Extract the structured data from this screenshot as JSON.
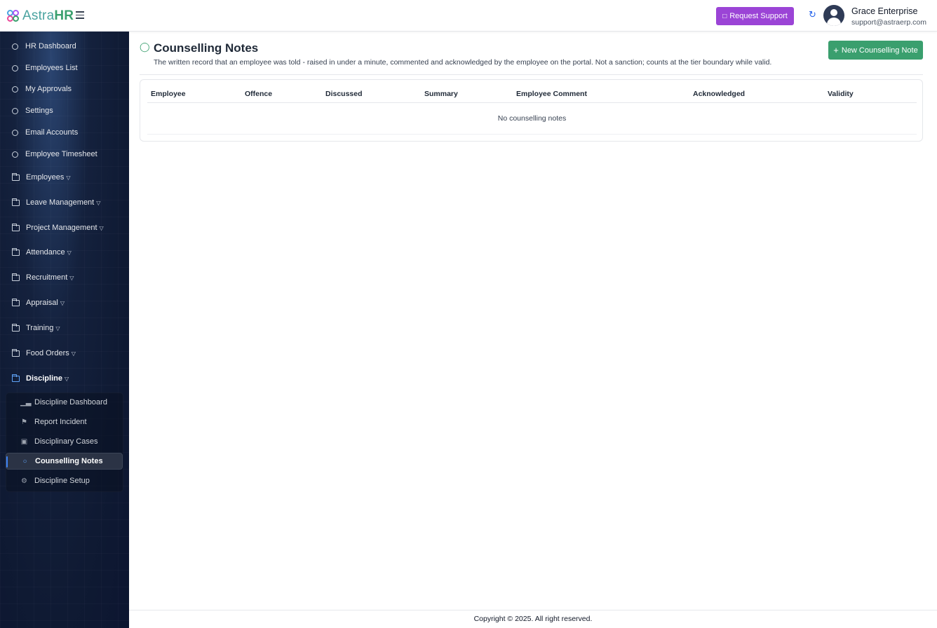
{
  "app": {
    "logo_prefix": "Astra",
    "logo_suffix": "HR"
  },
  "header": {
    "support_label": "Request Support",
    "user_name": "Grace Enterprise",
    "user_email": "support@astraerp.com"
  },
  "sidebar": {
    "items": [
      {
        "label": "HR Dashboard",
        "type": "link"
      },
      {
        "label": "Employees List",
        "type": "link"
      },
      {
        "label": "My Approvals",
        "type": "link"
      },
      {
        "label": "Settings",
        "type": "link"
      },
      {
        "label": "Email Accounts",
        "type": "link"
      },
      {
        "label": "Employee Timesheet",
        "type": "link"
      },
      {
        "label": "Employees",
        "type": "group"
      },
      {
        "label": "Leave Management",
        "type": "group"
      },
      {
        "label": "Project Management",
        "type": "group"
      },
      {
        "label": "Attendance",
        "type": "group"
      },
      {
        "label": "Recruitment",
        "type": "group"
      },
      {
        "label": "Appraisal",
        "type": "group"
      },
      {
        "label": "Training",
        "type": "group"
      },
      {
        "label": "Food Orders",
        "type": "group"
      },
      {
        "label": "Discipline",
        "type": "group",
        "expanded": true
      }
    ],
    "sub_items": [
      {
        "label": "Discipline Dashboard",
        "icon": "bar-chart-icon"
      },
      {
        "label": "Report Incident",
        "icon": "flag-icon"
      },
      {
        "label": "Disciplinary Cases",
        "icon": "briefcase-icon"
      },
      {
        "label": "Counselling Notes",
        "icon": "chat-icon",
        "active": true
      },
      {
        "label": "Discipline Setup",
        "icon": "gear-icon"
      }
    ]
  },
  "page": {
    "title": "Counselling Notes",
    "description": "The written record that an employee was told - raised in under a minute, commented and acknowledged by the employee on the portal. Not a sanction; counts at the tier boundary while valid.",
    "new_button_label": "New Counselling Note"
  },
  "table": {
    "columns": [
      "Employee",
      "Offence",
      "Discussed",
      "Summary",
      "Employee Comment",
      "Acknowledged",
      "Validity"
    ],
    "empty_text": "No counselling notes"
  },
  "footer": {
    "copyright": "Copyright © 2025. All right reserved."
  },
  "colors": {
    "brand_green": "#3a9f6e",
    "support_purple": "#9b44d6",
    "sidebar_bg": "#14213d",
    "active_accent": "#3b82f6"
  }
}
